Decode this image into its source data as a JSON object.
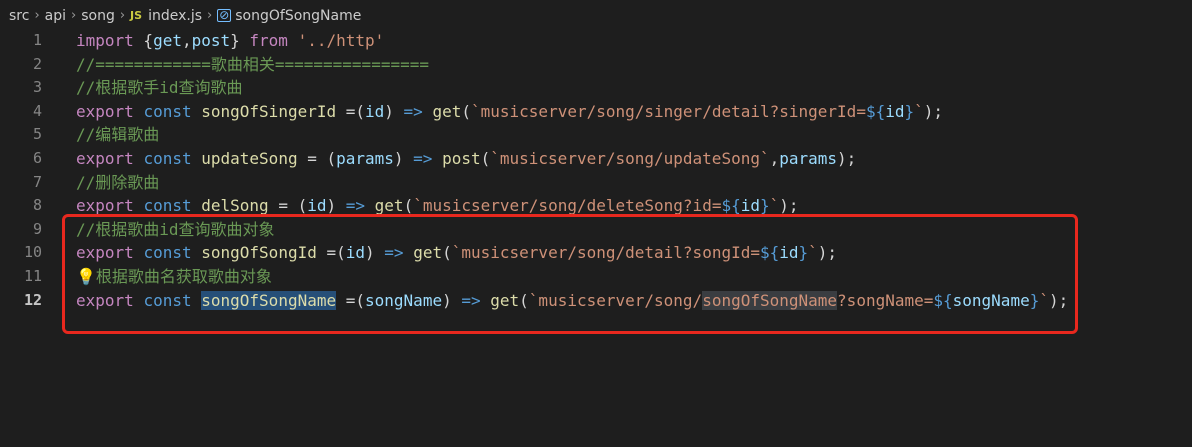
{
  "breadcrumb": {
    "items": [
      "src",
      "api",
      "song"
    ],
    "file_icon": "JS",
    "file": "index.js",
    "symbol_icon": "symbol-variable-icon",
    "symbol": "songOfSongName"
  },
  "lines": [
    {
      "num": "1",
      "t": [
        [
          "kw2",
          "import"
        ],
        [
          "op",
          " {"
        ],
        [
          "vr",
          "get"
        ],
        [
          "op",
          ","
        ],
        [
          "vr",
          "post"
        ],
        [
          "op",
          "} "
        ],
        [
          "kw2",
          "from"
        ],
        [
          "op",
          " "
        ],
        [
          "str",
          "'../http'"
        ]
      ]
    },
    {
      "num": "2",
      "t": [
        [
          "cm",
          "//============歌曲相关================"
        ]
      ]
    },
    {
      "num": "3",
      "t": [
        [
          "cm",
          "//根据歌手id查询歌曲"
        ]
      ]
    },
    {
      "num": "4",
      "t": [
        [
          "kw2",
          "export"
        ],
        [
          "op",
          " "
        ],
        [
          "kw",
          "const"
        ],
        [
          "op",
          " "
        ],
        [
          "fn",
          "songOfSingerId"
        ],
        [
          "op",
          " =("
        ],
        [
          "vr",
          "id"
        ],
        [
          "op",
          ") "
        ],
        [
          "kw",
          "=>"
        ],
        [
          "op",
          " "
        ],
        [
          "fn",
          "get"
        ],
        [
          "op",
          "("
        ],
        [
          "str",
          "`musicserver/song/singer/detail?singerId="
        ],
        [
          "tpl",
          "${"
        ],
        [
          "vr",
          "id"
        ],
        [
          "tpl",
          "}"
        ],
        [
          "str",
          "`"
        ],
        [
          "op",
          ");"
        ]
      ]
    },
    {
      "num": "5",
      "t": [
        [
          "cm",
          "//编辑歌曲"
        ]
      ]
    },
    {
      "num": "6",
      "t": [
        [
          "kw2",
          "export"
        ],
        [
          "op",
          " "
        ],
        [
          "kw",
          "const"
        ],
        [
          "op",
          " "
        ],
        [
          "fn",
          "updateSong"
        ],
        [
          "op",
          " = ("
        ],
        [
          "vr",
          "params"
        ],
        [
          "op",
          ") "
        ],
        [
          "kw",
          "=>"
        ],
        [
          "op",
          " "
        ],
        [
          "fn",
          "post"
        ],
        [
          "op",
          "("
        ],
        [
          "str",
          "`musicserver/song/updateSong`"
        ],
        [
          "op",
          ","
        ],
        [
          "vr",
          "params"
        ],
        [
          "op",
          ");"
        ]
      ]
    },
    {
      "num": "7",
      "t": [
        [
          "cm",
          "//删除歌曲"
        ]
      ]
    },
    {
      "num": "8",
      "t": [
        [
          "kw2",
          "export"
        ],
        [
          "op",
          " "
        ],
        [
          "kw",
          "const"
        ],
        [
          "op",
          " "
        ],
        [
          "fn",
          "delSong"
        ],
        [
          "op",
          " = ("
        ],
        [
          "vr",
          "id"
        ],
        [
          "op",
          ") "
        ],
        [
          "kw",
          "=>"
        ],
        [
          "op",
          " "
        ],
        [
          "fn",
          "get"
        ],
        [
          "op",
          "("
        ],
        [
          "str",
          "`musicserver/song/deleteSong?id="
        ],
        [
          "tpl",
          "${"
        ],
        [
          "vr",
          "id"
        ],
        [
          "tpl",
          "}"
        ],
        [
          "str",
          "`"
        ],
        [
          "op",
          ");"
        ]
      ]
    },
    {
      "num": "9",
      "t": [
        [
          "cm",
          "//根据歌曲id查询歌曲对象"
        ]
      ]
    },
    {
      "num": "10",
      "t": [
        [
          "kw2",
          "export"
        ],
        [
          "op",
          " "
        ],
        [
          "kw",
          "const"
        ],
        [
          "op",
          " "
        ],
        [
          "fn",
          "songOfSongId"
        ],
        [
          "op",
          " =("
        ],
        [
          "vr",
          "id"
        ],
        [
          "op",
          ") "
        ],
        [
          "kw",
          "=>"
        ],
        [
          "op",
          " "
        ],
        [
          "fn",
          "get"
        ],
        [
          "op",
          "("
        ],
        [
          "str",
          "`musicserver/song/detail?songId="
        ],
        [
          "tpl",
          "${"
        ],
        [
          "vr",
          "id"
        ],
        [
          "tpl",
          "}"
        ],
        [
          "str",
          "`"
        ],
        [
          "op",
          ");"
        ]
      ]
    },
    {
      "num": "11",
      "t": [
        [
          "bulb",
          "💡"
        ],
        [
          "cm",
          "根据歌曲名获取歌曲对象"
        ]
      ]
    },
    {
      "num": "12",
      "active": true,
      "t": [
        [
          "kw2",
          "export"
        ],
        [
          "op",
          " "
        ],
        [
          "kw",
          "const"
        ],
        [
          "op",
          " "
        ],
        [
          "fn hl-word",
          "songOfSongName"
        ],
        [
          "op",
          " =("
        ],
        [
          "vr",
          "songName"
        ],
        [
          "op",
          ") "
        ],
        [
          "kw",
          "=>"
        ],
        [
          "op",
          " "
        ],
        [
          "fn",
          "get"
        ],
        [
          "op",
          "("
        ],
        [
          "str",
          "`musicserver/song/"
        ],
        [
          "str hl-sel",
          "songOfSongName"
        ],
        [
          "str",
          "?songName="
        ],
        [
          "tpl",
          "${"
        ],
        [
          "vr",
          "songName"
        ],
        [
          "tpl",
          "}"
        ],
        [
          "str",
          "`"
        ],
        [
          "op",
          ");"
        ]
      ]
    }
  ],
  "annotation": {
    "color": "#e8281e"
  }
}
